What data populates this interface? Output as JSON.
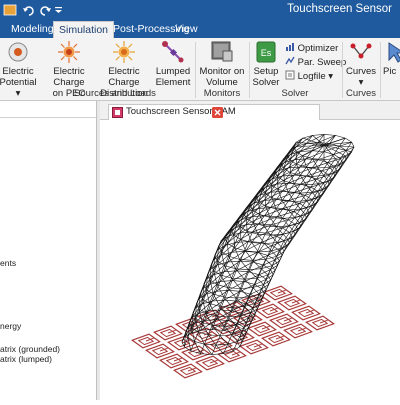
{
  "window": {
    "title": "Touchscreen Sensor"
  },
  "quick_access": {
    "undo_icon": "undo-icon",
    "redo_icon": "redo-icon"
  },
  "tabs": [
    {
      "label": "Modeling",
      "active": false
    },
    {
      "label": "Simulation",
      "active": true
    },
    {
      "label": "Post-Processing",
      "active": false
    },
    {
      "label": "View",
      "active": false
    }
  ],
  "ribbon": {
    "electric_potential": {
      "line1": "Electric",
      "line2": "Potential ▾"
    },
    "charge_pec": {
      "line1": "Electric Charge",
      "line2": "on PEC"
    },
    "charge_dist": {
      "line1": "Electric Charge",
      "line2": "Distribution"
    },
    "lumped": {
      "line1": "Lumped",
      "line2": "Element"
    },
    "monitor": {
      "line1": "Monitor on",
      "line2": "Volume"
    },
    "setup_solver": {
      "line1": "Setup",
      "line2": "Solver"
    },
    "optimizer": "Optimizer",
    "par_sweep": "Par. Sweep",
    "logfile": "Logfile ▾",
    "curves": "Curves",
    "curves_arrow": "▾",
    "pick": "Pic",
    "groups": {
      "sources": "Sources and Loads",
      "monitors": "Monitors",
      "solver": "Solver",
      "curves": "Curves"
    },
    "colors": {
      "accent": "#1f5a9e",
      "ribbon_bg": "#f3f3f3"
    }
  },
  "tree": {
    "items": [
      "ents",
      "nergy",
      "atrix (grounded)",
      "atrix (lumped)"
    ]
  },
  "document": {
    "tab_label": "Touchscreen Sensor SAM",
    "close_icon": "close-icon"
  }
}
